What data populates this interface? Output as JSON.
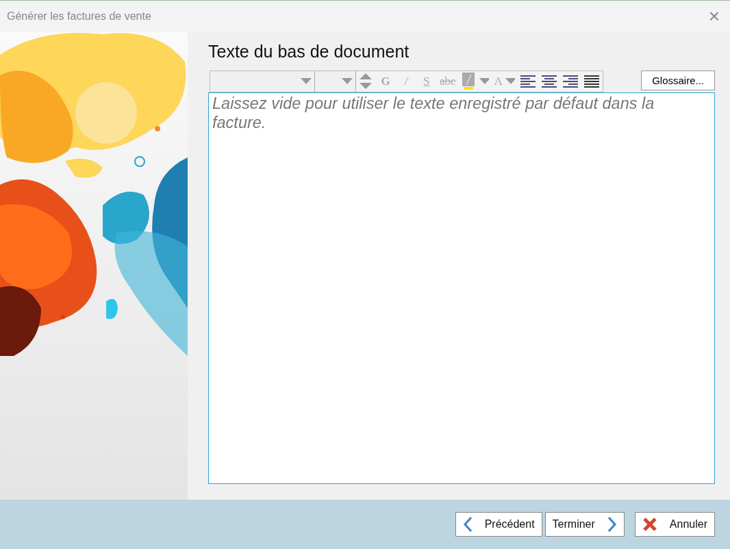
{
  "window": {
    "title": "Générer les factures de vente",
    "close": "×"
  },
  "heading": "Texte du bas de document",
  "toolbar": [
    {
      "kind": "font-select"
    },
    {
      "kind": "size-select"
    },
    {
      "kind": "spinner"
    },
    {
      "kind": "bold",
      "label": "G"
    },
    {
      "kind": "italic",
      "label": "/"
    },
    {
      "kind": "underline",
      "label": "S"
    },
    {
      "kind": "strike",
      "label": "abc"
    },
    {
      "kind": "highlight"
    },
    {
      "kind": "color",
      "label": "A"
    },
    {
      "kind": "align-left"
    },
    {
      "kind": "align-center"
    },
    {
      "kind": "align-right"
    },
    {
      "kind": "align-justify"
    }
  ],
  "toolbar_disabled": true,
  "glossary_button": "Glossaire...",
  "editor": {
    "placeholder": "Laissez vide pour utiliser le texte enregistré par défaut dans la facture."
  },
  "footer_buttons": [
    {
      "kind": "back",
      "label": "Précédent"
    },
    {
      "kind": "next",
      "label": "Terminer"
    },
    {
      "kind": "cancel",
      "label": "Annuler"
    }
  ]
}
